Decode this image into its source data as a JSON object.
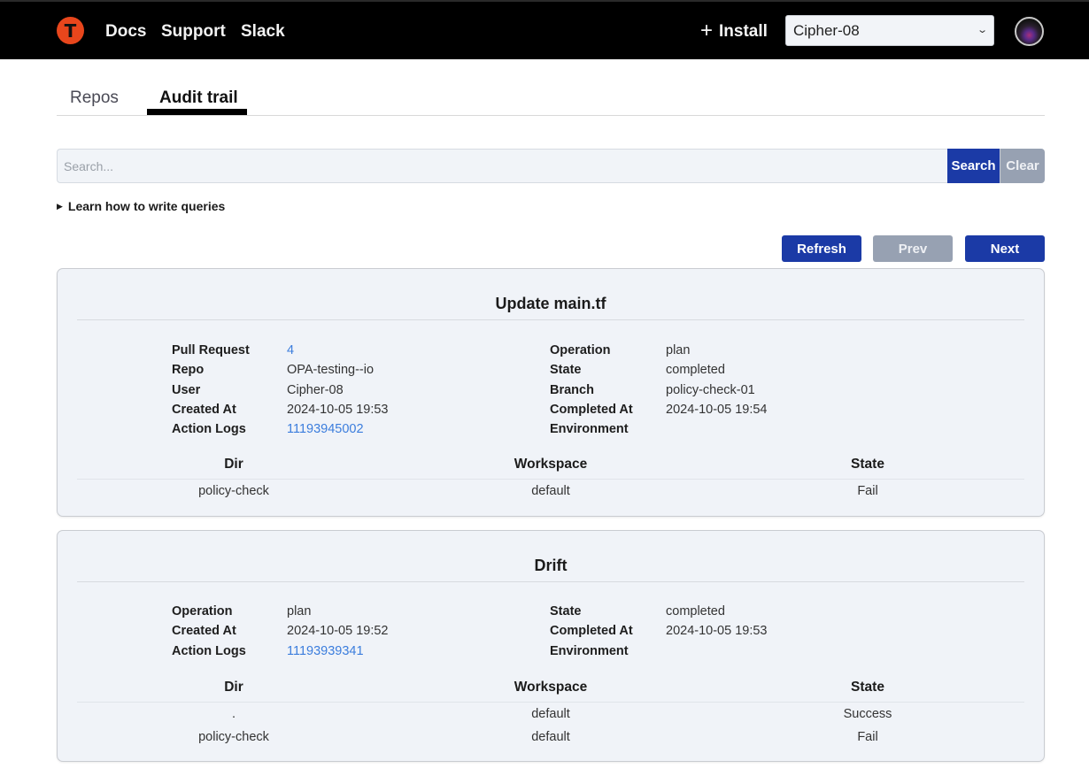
{
  "nav": {
    "logo_letter": "T",
    "links": [
      "Docs",
      "Support",
      "Slack"
    ],
    "install_label": "Install",
    "install_icon": "plus-icon",
    "org_select": {
      "selected": "Cipher-08"
    },
    "avatar_icon": "user-avatar"
  },
  "tabs": [
    {
      "label": "Repos",
      "active": false
    },
    {
      "label": "Audit trail",
      "active": true
    }
  ],
  "search": {
    "placeholder": "Search...",
    "value": "",
    "search_label": "Search",
    "clear_label": "Clear"
  },
  "learn_queries": {
    "label": "Learn how to write queries",
    "icon": "disclosure-triangle-icon"
  },
  "pager": {
    "refresh_label": "Refresh",
    "prev_label": "Prev",
    "next_label": "Next"
  },
  "colors": {
    "primary": "#1b3aa6",
    "disabled": "#97a1b2",
    "link": "#3b7ddd",
    "logo": "#e8461c"
  },
  "runs": [
    {
      "title": "Update main.tf",
      "left": [
        {
          "label": "Pull Request",
          "value": "4",
          "link": true
        },
        {
          "label": "Repo",
          "value": "OPA-testing--io"
        },
        {
          "label": "User",
          "value": "Cipher-08"
        },
        {
          "label": "Created At",
          "value": "2024-10-05 19:53"
        },
        {
          "label": "Action Logs",
          "value": "11193945002",
          "link": true
        }
      ],
      "right": [
        {
          "label": "Operation",
          "value": "plan"
        },
        {
          "label": "State",
          "value": "completed"
        },
        {
          "label": "Branch",
          "value": "policy-check-01"
        },
        {
          "label": "Completed At",
          "value": "2024-10-05 19:54"
        },
        {
          "label": "Environment",
          "value": ""
        }
      ],
      "table": {
        "headers": [
          "Dir",
          "Workspace",
          "State"
        ],
        "rows": [
          [
            "policy-check",
            "default",
            "Fail"
          ]
        ]
      }
    },
    {
      "title": "Drift",
      "left": [
        {
          "label": "Operation",
          "value": "plan"
        },
        {
          "label": "Created At",
          "value": "2024-10-05 19:52"
        },
        {
          "label": "Action Logs",
          "value": "11193939341",
          "link": true
        }
      ],
      "right": [
        {
          "label": "State",
          "value": "completed"
        },
        {
          "label": "Completed At",
          "value": "2024-10-05 19:53"
        },
        {
          "label": "Environment",
          "value": ""
        }
      ],
      "table": {
        "headers": [
          "Dir",
          "Workspace",
          "State"
        ],
        "rows": [
          [
            ".",
            "default",
            "Success"
          ],
          [
            "policy-check",
            "default",
            "Fail"
          ]
        ]
      }
    }
  ]
}
